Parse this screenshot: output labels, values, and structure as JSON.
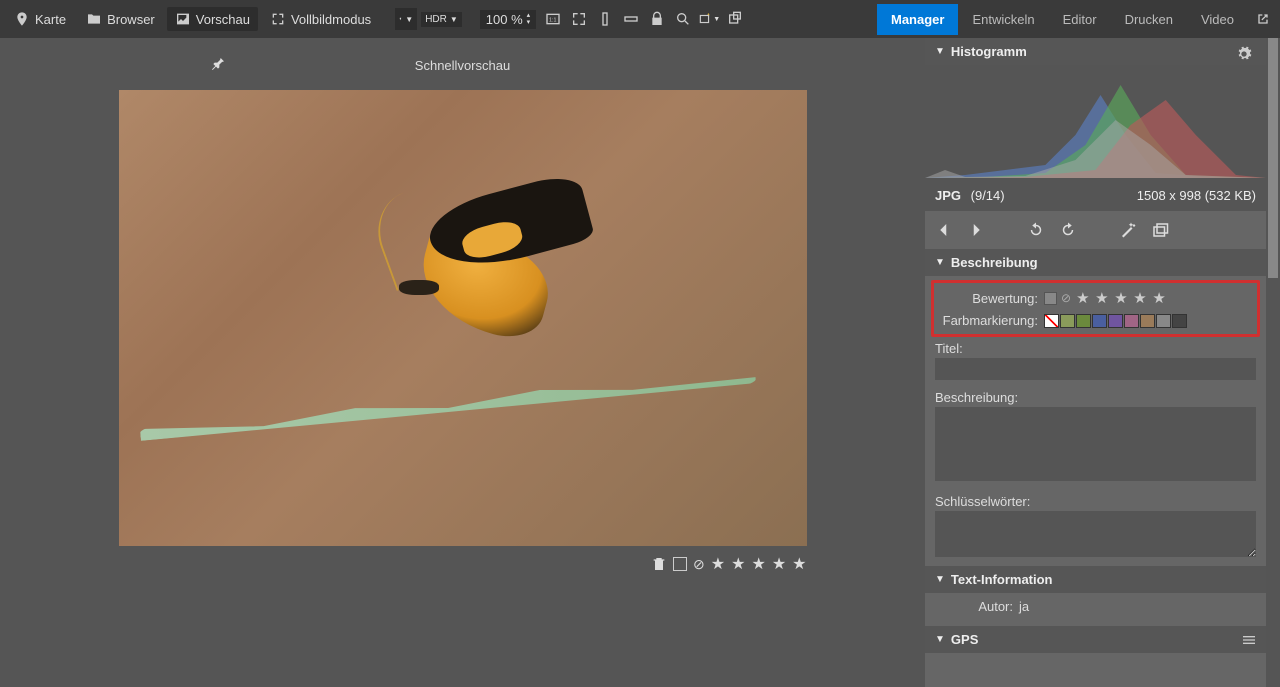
{
  "toolbar": {
    "karte": "Karte",
    "browser": "Browser",
    "vorschau": "Vorschau",
    "vollbild": "Vollbildmodus",
    "zoom": "100 %",
    "hdr": "HDR"
  },
  "nav": {
    "manager": "Manager",
    "entwickeln": "Entwickeln",
    "editor": "Editor",
    "drucken": "Drucken",
    "video": "Video"
  },
  "preview": {
    "title": "Schnellvorschau"
  },
  "histogram": {
    "title": "Histogramm"
  },
  "fileinfo": {
    "format": "JPG",
    "index": "(9/14)",
    "dimensions": "1508 x 998 (532 KB)"
  },
  "description": {
    "title": "Beschreibung",
    "rating_label": "Bewertung:",
    "color_label": "Farbmarkierung:",
    "title_field": "Titel:",
    "desc_field": "Beschreibung:",
    "keywords_field": "Schlüsselwörter:",
    "swatches": [
      "#8a9b5b",
      "#6b8a3d",
      "#4a5fa0",
      "#7055a0",
      "#a06585",
      "#9a7b5a",
      "#888888",
      "#444444"
    ]
  },
  "textinfo": {
    "title": "Text-Information",
    "author_label": "Autor:",
    "author_value": "ja"
  },
  "gps": {
    "title": "GPS"
  }
}
